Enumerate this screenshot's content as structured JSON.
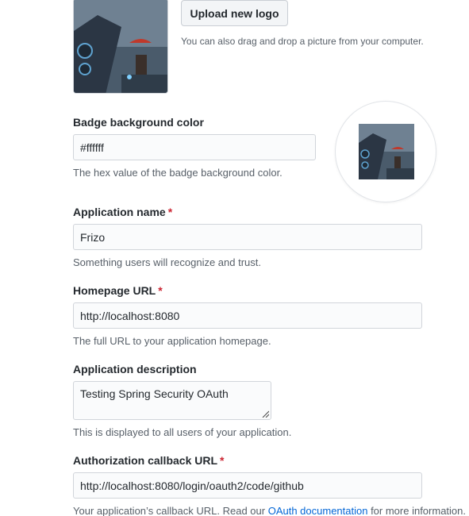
{
  "logo": {
    "upload_label": "Upload new logo",
    "drag_note": "You can also drag and drop a picture from your computer."
  },
  "badge": {
    "label": "Badge background color",
    "value": "#ffffff",
    "note": "The hex value of the badge background color."
  },
  "app_name": {
    "label": "Application name",
    "required_mark": "*",
    "value": "Frizo",
    "note": "Something users will recognize and trust."
  },
  "homepage_url": {
    "label": "Homepage URL",
    "required_mark": "*",
    "value": "http://localhost:8080",
    "note": "The full URL to your application homepage."
  },
  "description": {
    "label": "Application description",
    "value": "Testing Spring Security OAuth",
    "note": "This is displayed to all users of your application."
  },
  "callback_url": {
    "label": "Authorization callback URL",
    "required_mark": "*",
    "value": "http://localhost:8080/login/oauth2/code/github",
    "note_before": "Your application’s callback URL. Read our ",
    "note_link": "OAuth documentation",
    "note_after": " for more information."
  },
  "colors": {
    "required": "#cb2431",
    "link": "#0366d6",
    "muted_text": "#586069",
    "input_border": "#d1d5da"
  }
}
